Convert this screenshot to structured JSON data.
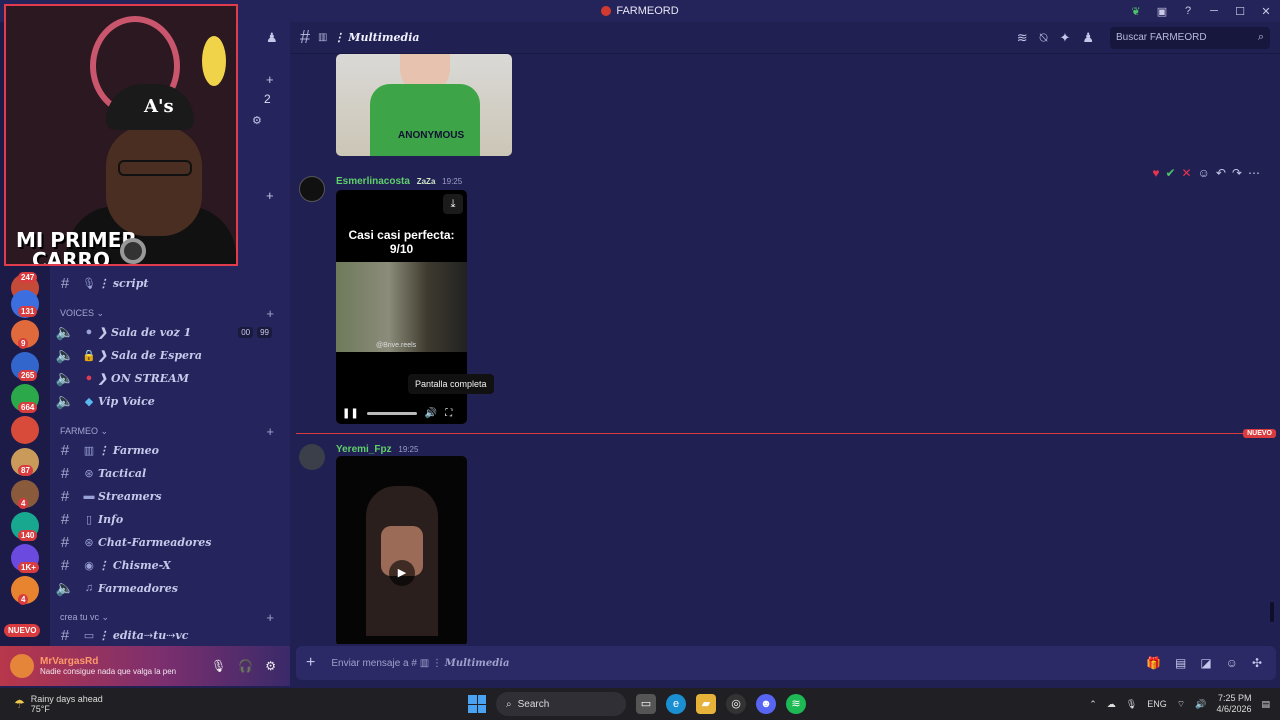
{
  "window": {
    "title": "FARMEORD"
  },
  "header": {
    "channel_emoji": "▥",
    "channel_name": "⋮ Multimedia",
    "search_placeholder": "Buscar FARMEORD"
  },
  "rail": {
    "badges": [
      "247",
      "131",
      "9",
      "265",
      "664",
      "87",
      "4",
      "140",
      "1K+",
      "4"
    ],
    "nuevo": "NUEVO",
    "top_badge": "2"
  },
  "sidebar": {
    "channels_top": [
      {
        "emoji": "🎙",
        "name": "⋮ script"
      }
    ],
    "categories": [
      {
        "name": "VOICES ⌄"
      },
      {
        "name": "FARMEO ⌄"
      },
      {
        "name": "crea tu vc ⌄"
      }
    ],
    "voices": [
      {
        "emoji": "🔈",
        "name": "❯ Sala de voz 1",
        "counts": [
          "00",
          "99"
        ]
      },
      {
        "emoji": "🔒",
        "name": "❯ Sala de Espera"
      },
      {
        "emoji": "🔴",
        "name": "❯ ON STREAM"
      },
      {
        "emoji": "💎",
        "name": "Vip Voice"
      }
    ],
    "farmeo": [
      {
        "emoji": "▥",
        "name": "⋮ Farmeo"
      },
      {
        "emoji": "⊛",
        "name": "Tactical"
      },
      {
        "emoji": "▬",
        "name": "Streamers"
      },
      {
        "emoji": "▯",
        "name": "Info"
      },
      {
        "emoji": "⊛",
        "name": "Chat-Farmeadores"
      },
      {
        "emoji": "◉",
        "name": "⋮ Chisme-X"
      },
      {
        "emoji": "♫",
        "name": "Farmeadores"
      }
    ],
    "crea": [
      {
        "emoji": "▭",
        "name": "⋮ edita⇢tu⇢vc"
      }
    ]
  },
  "user": {
    "name": "MrVargasRd",
    "status": "Nadie consigue nada que valga la pen"
  },
  "webcam": {
    "line1": "MI PRIMER",
    "line2": "CARRO",
    "cap_logo": "A's"
  },
  "messages": [
    {
      "author": "Esmerlinacosta",
      "role": "ZaZa",
      "time": "19:25",
      "author_color": "#5fd06a",
      "video_caption": "Casi casi perfecta:",
      "video_caption2": "9/10",
      "watermark": "@Brive.reels"
    },
    {
      "author": "Yeremi_Fpz",
      "time": "19:25",
      "author_color": "#5fd06a"
    }
  ],
  "top_image_text": "ANONYMOUS",
  "tooltip": "Pantalla completa",
  "new_label": "NUEVO",
  "composer": {
    "placeholder_prefix": "Enviar mensaje a #",
    "placeholder_channel": "Multimedia"
  },
  "taskbar": {
    "weather_title": "Rainy days ahead",
    "weather_temp": "75°F",
    "search_label": "Search",
    "lang": "ENG",
    "time": "7:25 PM",
    "date": "4/6/2026"
  },
  "colors": {
    "accent": "#d83c3e",
    "bg": "#212052",
    "sidebar": "#25245c"
  }
}
